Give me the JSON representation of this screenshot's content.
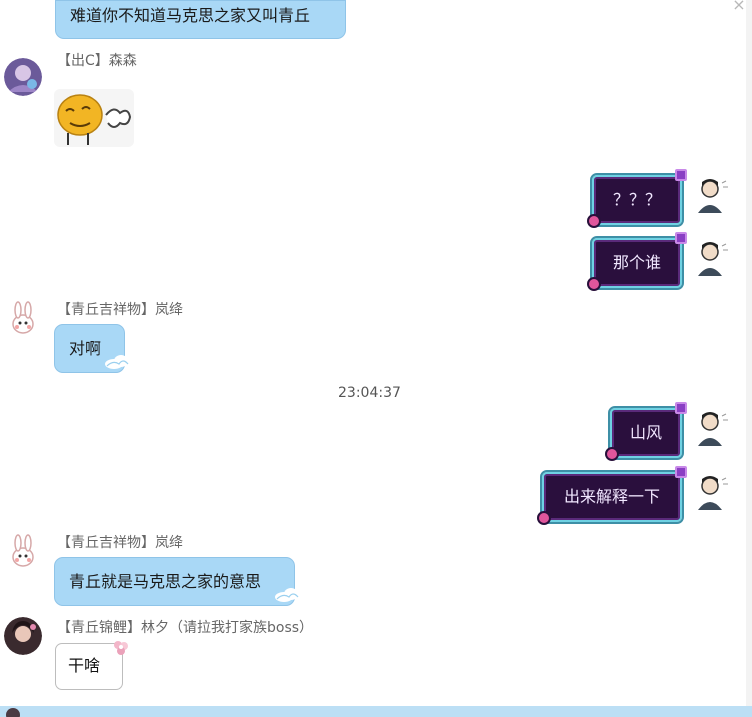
{
  "messages": {
    "m1_text": "难道你不知道马克思之家又叫青丘",
    "m2_sender": "【出C】森森",
    "m3_text": "？？？",
    "m4_text": "那个谁",
    "m5_sender": "【青丘吉祥物】岚绛",
    "m5_text": "对啊",
    "timestamp": "23:04:37",
    "m6_text": "山风",
    "m7_text": "出来解释一下",
    "m8_sender": "【青丘吉祥物】岚绛",
    "m8_text": "青丘就是马克思之家的意思",
    "m9_sender": "【青丘锦鲤】林夕（请拉我打家族boss）",
    "m9_text": "干啥"
  },
  "colors": {
    "bubble_blue": "#a9d8f6",
    "bubble_purple": "#2a0f3d",
    "purple_border": "#6fd2e3"
  }
}
